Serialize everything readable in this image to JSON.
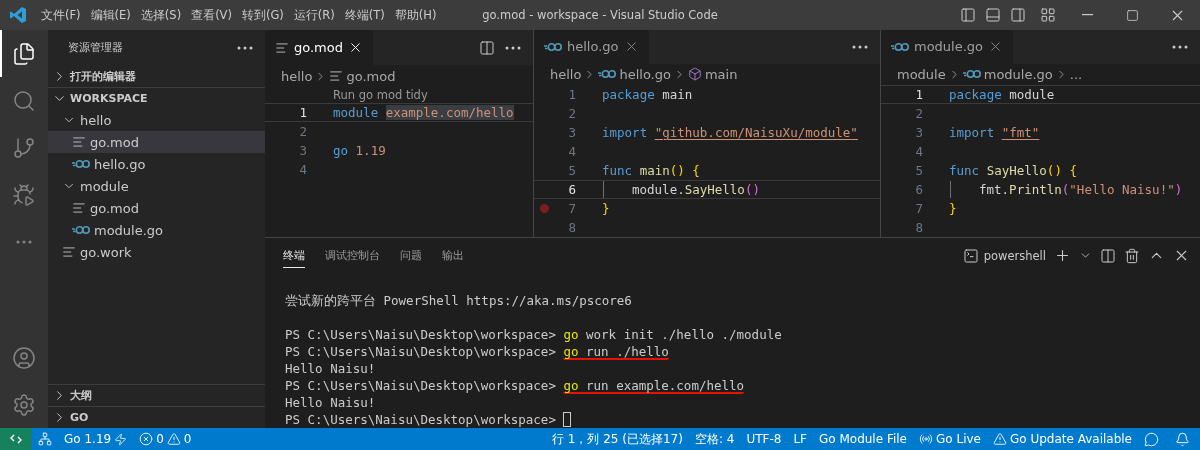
{
  "title_bar": {
    "menus": [
      "文件(F)",
      "编辑(E)",
      "选择(S)",
      "查看(V)",
      "转到(G)",
      "运行(R)",
      "终端(T)",
      "帮助(H)"
    ],
    "title": "go.mod - workspace - Visual Studio Code"
  },
  "activity_bar": {
    "top": [
      {
        "kind": "files",
        "selected": true
      },
      {
        "kind": "search",
        "selected": false
      },
      {
        "kind": "source-control",
        "selected": false
      },
      {
        "kind": "run-debug",
        "selected": false
      },
      {
        "kind": "more",
        "selected": false
      }
    ],
    "bottom": [
      {
        "kind": "account",
        "selected": false
      },
      {
        "kind": "settings",
        "selected": false
      }
    ]
  },
  "sidebar": {
    "title": "资源管理器",
    "open_editors": {
      "label": "打开的编辑器",
      "expanded": false
    },
    "workspace": {
      "label": "WORKSPACE",
      "expanded": true
    },
    "tree": [
      {
        "label": "hello",
        "kind": "folder",
        "expanded": true,
        "selected": false,
        "children": [
          {
            "label": "go.mod",
            "kind": "mod",
            "selected": true
          },
          {
            "label": "hello.go",
            "kind": "go",
            "selected": false
          }
        ]
      },
      {
        "label": "module",
        "kind": "folder",
        "expanded": true,
        "selected": false,
        "children": [
          {
            "label": "go.mod",
            "kind": "mod",
            "selected": false
          },
          {
            "label": "module.go",
            "kind": "go",
            "selected": false
          }
        ]
      },
      {
        "label": "go.work",
        "kind": "mod",
        "selected": false
      }
    ],
    "bottom_sections": [
      {
        "label": "大纲",
        "expanded": false
      },
      {
        "label": "GO",
        "expanded": false
      }
    ]
  },
  "editor_groups": [
    {
      "focused": true,
      "tab": {
        "label": "go.mod",
        "kind": "mod",
        "selected": true
      },
      "breadcrumbs": [
        {
          "text": "hello",
          "kind": "folder"
        },
        {
          "text": "go.mod",
          "kind": "mod"
        }
      ],
      "codelens": "Run go mod tidy",
      "lines": [
        {
          "n": "1",
          "current": true,
          "tokens": [
            {
              "t": "module ",
              "kind": "keyword"
            },
            {
              "t": "example.com/hello",
              "kind": "string",
              "highlighted": true
            }
          ]
        },
        {
          "n": "2",
          "current": false
        },
        {
          "n": "3",
          "current": false,
          "tokens": [
            {
              "t": "go ",
              "kind": "keyword"
            },
            {
              "t": "1.19",
              "kind": "string"
            }
          ]
        },
        {
          "n": "4",
          "current": false
        }
      ]
    },
    {
      "focused": false,
      "tab": {
        "label": "hello.go",
        "kind": "go",
        "selected": true
      },
      "breadcrumbs": [
        {
          "text": "hello",
          "kind": "folder"
        },
        {
          "text": "hello.go",
          "kind": "go"
        },
        {
          "text": "main",
          "kind": "symbol"
        }
      ],
      "lines": [
        {
          "n": "1",
          "current": false,
          "tokens": [
            {
              "t": "package ",
              "kind": "keyword"
            },
            {
              "t": "main",
              "kind": "plain"
            }
          ]
        },
        {
          "n": "2",
          "current": false
        },
        {
          "n": "3",
          "current": false,
          "tokens": [
            {
              "t": "import ",
              "kind": "keyword"
            },
            {
              "t": "\"github.com/NaisuXu/module\"",
              "kind": "string",
              "underlined": true
            }
          ]
        },
        {
          "n": "4",
          "current": false
        },
        {
          "n": "5",
          "current": false,
          "tokens": [
            {
              "t": "func ",
              "kind": "keyword"
            },
            {
              "t": "main",
              "kind": "function"
            },
            {
              "t": "() {",
              "kind": "bracket1"
            }
          ]
        },
        {
          "n": "6",
          "current": true,
          "indent": true,
          "tokens": [
            {
              "t": "module.",
              "kind": "plain"
            },
            {
              "t": "SayHello",
              "kind": "function"
            },
            {
              "t": "()",
              "kind": "bracket2"
            }
          ]
        },
        {
          "n": "7",
          "current": false,
          "breakpoint": true,
          "tokens": [
            {
              "t": "}",
              "kind": "bracket1"
            }
          ]
        },
        {
          "n": "8",
          "current": false
        }
      ]
    },
    {
      "focused": false,
      "tab": {
        "label": "module.go",
        "kind": "go",
        "selected": true
      },
      "breadcrumbs": [
        {
          "text": "module",
          "kind": "folder"
        },
        {
          "text": "module.go",
          "kind": "go"
        },
        {
          "text": "...",
          "kind": "folder"
        }
      ],
      "lines": [
        {
          "n": "1",
          "current": true,
          "tokens": [
            {
              "t": "package ",
              "kind": "keyword"
            },
            {
              "t": "module",
              "kind": "plain"
            }
          ]
        },
        {
          "n": "2",
          "current": false
        },
        {
          "n": "3",
          "current": false,
          "tokens": [
            {
              "t": "import ",
              "kind": "keyword"
            },
            {
              "t": "\"fmt\"",
              "kind": "string",
              "underlined": true
            }
          ]
        },
        {
          "n": "4",
          "current": false
        },
        {
          "n": "5",
          "current": false,
          "tokens": [
            {
              "t": "func ",
              "kind": "keyword"
            },
            {
              "t": "SayHello",
              "kind": "function"
            },
            {
              "t": "() {",
              "kind": "bracket1"
            }
          ]
        },
        {
          "n": "6",
          "current": false,
          "indent": true,
          "tokens": [
            {
              "t": "fmt.",
              "kind": "plain"
            },
            {
              "t": "Println",
              "kind": "function"
            },
            {
              "t": "(",
              "kind": "bracket2"
            },
            {
              "t": "\"Hello Naisu!\"",
              "kind": "string"
            },
            {
              "t": ")",
              "kind": "bracket2"
            }
          ]
        },
        {
          "n": "7",
          "current": false,
          "tokens": [
            {
              "t": "}",
              "kind": "bracket1"
            }
          ]
        },
        {
          "n": "8",
          "current": false
        }
      ]
    }
  ],
  "panel": {
    "tabs": [
      {
        "label": "终端",
        "selected": true
      },
      {
        "label": "调试控制台",
        "selected": false
      },
      {
        "label": "问题",
        "selected": false
      },
      {
        "label": "输出",
        "selected": false
      }
    ],
    "shell": "powershell",
    "terminal": [
      {
        "kind": "text",
        "text": "尝试新的跨平台 PowerShell https://aka.ms/pscore6"
      },
      {
        "kind": "blank"
      },
      {
        "kind": "command",
        "prompt": "PS C:\\Users\\Naisu\\Desktop\\workspace>",
        "cmd": "go",
        "args": "work init ./hello ./module",
        "annotated": false
      },
      {
        "kind": "command",
        "prompt": "PS C:\\Users\\Naisu\\Desktop\\workspace>",
        "cmd": "go",
        "args": "run ./hello",
        "annotated": true
      },
      {
        "kind": "text",
        "text": "Hello Naisu!"
      },
      {
        "kind": "command",
        "prompt": "PS C:\\Users\\Naisu\\Desktop\\workspace>",
        "cmd": "go",
        "args": "run example.com/hello",
        "annotated": true
      },
      {
        "kind": "text",
        "text": "Hello Naisu!"
      },
      {
        "kind": "cursor",
        "prompt": "PS C:\\Users\\Naisu\\Desktop\\workspace>"
      }
    ]
  },
  "status_bar": {
    "left": [
      {
        "kind": "remote"
      },
      {
        "kind": "tools"
      },
      {
        "kind": "version",
        "text": "Go 1.19"
      },
      {
        "kind": "problems",
        "errors": "0",
        "warnings": "0"
      }
    ],
    "right": [
      {
        "kind": "text",
        "text": "行 1，列 25 (已选择17)"
      },
      {
        "kind": "text",
        "text": "空格: 4"
      },
      {
        "kind": "text",
        "text": "UTF-8"
      },
      {
        "kind": "text",
        "text": "LF"
      },
      {
        "kind": "text",
        "text": "Go Module File"
      },
      {
        "kind": "live",
        "text": "Go Live"
      },
      {
        "kind": "update",
        "text": "Go Update Available"
      },
      {
        "kind": "feedback"
      },
      {
        "kind": "bell"
      }
    ]
  }
}
